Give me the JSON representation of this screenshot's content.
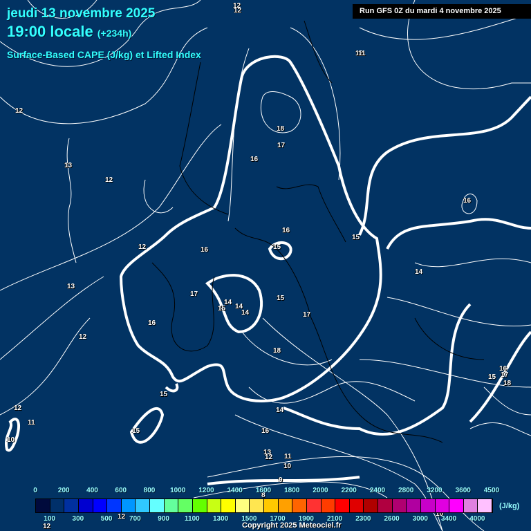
{
  "header": {
    "date": "jeudi 13 novembre 2025",
    "time": "19:00 locale",
    "offset": "(+234h)",
    "product": "Surface-Based CAPE (J/kg) et Lifted Index",
    "run": "Run GFS 0Z du mardi 4 novembre 2025"
  },
  "contour_labels": [
    "12",
    "12",
    "12",
    "12",
    "13",
    "12",
    "12",
    "13",
    "12",
    "16",
    "18",
    "17",
    "16",
    "16",
    "15",
    "15",
    "16",
    "17",
    "14",
    "14",
    "14",
    "15",
    "15",
    "17",
    "16",
    "18",
    "12",
    "15",
    "15",
    "14",
    "16",
    "14",
    "15",
    "16",
    "17",
    "18",
    "13",
    "12",
    "11",
    "10",
    "9",
    "8",
    "10",
    "11",
    "10",
    "12",
    "12",
    "11"
  ],
  "legend": {
    "top_ticks": [
      "0",
      "200",
      "400",
      "600",
      "800",
      "1000",
      "1200",
      "1400",
      "1600",
      "1800",
      "2000",
      "2200",
      "2400",
      "2800",
      "3200",
      "3600",
      "4500"
    ],
    "bottom_ticks": [
      "100",
      "300",
      "500",
      "700",
      "900",
      "1100",
      "1300",
      "1500",
      "1700",
      "1900",
      "2100",
      "2300",
      "2600",
      "3000",
      "3400",
      "4000"
    ],
    "unit": "(J/kg)",
    "colors": [
      "#000a3c",
      "#00306a",
      "#0030a0",
      "#0000d0",
      "#0000ff",
      "#0036ff",
      "#0096ff",
      "#30c8ff",
      "#64ffff",
      "#64ff9c",
      "#64ff64",
      "#64ff00",
      "#c8ff14",
      "#ffff00",
      "#ffff80",
      "#ffe650",
      "#ffc800",
      "#ffa000",
      "#ff6400",
      "#ff3232",
      "#ff3c00",
      "#ff0000",
      "#e00000",
      "#b00000",
      "#b00040",
      "#b00070",
      "#b000a0",
      "#c800c8",
      "#e000e0",
      "#ff00ff",
      "#e080e0",
      "#ffc0ff",
      "#ffffff"
    ]
  },
  "copyright": "Copyright 2025 Meteociel.fr"
}
